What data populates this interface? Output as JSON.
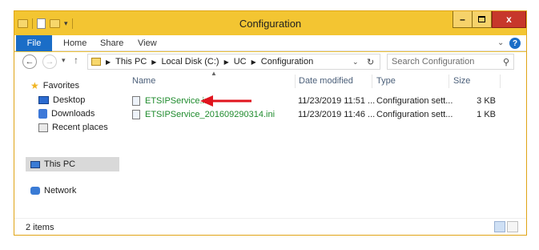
{
  "window": {
    "title": "Configuration",
    "colors": {
      "frame": "#f3c532",
      "file_tab": "#1a6dc7",
      "close": "#c7372b",
      "file_name": "#1f8b2d",
      "annotation_arrow": "#e0141e"
    }
  },
  "window_controls": {
    "minimize": "–",
    "close": "x"
  },
  "ribbon": {
    "tabs": [
      "File",
      "Home",
      "Share",
      "View"
    ],
    "help": "?"
  },
  "address_bar": {
    "crumbs": [
      "This PC",
      "Local Disk (C:)",
      "UC",
      "Configuration"
    ],
    "search_placeholder": "Search Configuration"
  },
  "nav_pane": {
    "favorites": {
      "label": "Favorites",
      "icon": "star-icon"
    },
    "favorite_items": [
      {
        "label": "Desktop",
        "icon": "desktop-icon"
      },
      {
        "label": "Downloads",
        "icon": "downloads-icon"
      },
      {
        "label": "Recent places",
        "icon": "recent-places-icon"
      }
    ],
    "this_pc": {
      "label": "This PC",
      "icon": "computer-icon"
    },
    "network": {
      "label": "Network",
      "icon": "network-icon"
    }
  },
  "file_list": {
    "columns": [
      "Name",
      "Date modified",
      "Type",
      "Size"
    ],
    "rows": [
      {
        "name": "ETSIPService.ini",
        "date": "11/23/2019 11:51 ...",
        "type": "Configuration sett...",
        "size": "3 KB"
      },
      {
        "name": "ETSIPService_201609290314.ini",
        "date": "11/23/2019 11:46 ...",
        "type": "Configuration sett...",
        "size": "1 KB"
      }
    ]
  },
  "status_bar": {
    "item_count": "2 items"
  }
}
